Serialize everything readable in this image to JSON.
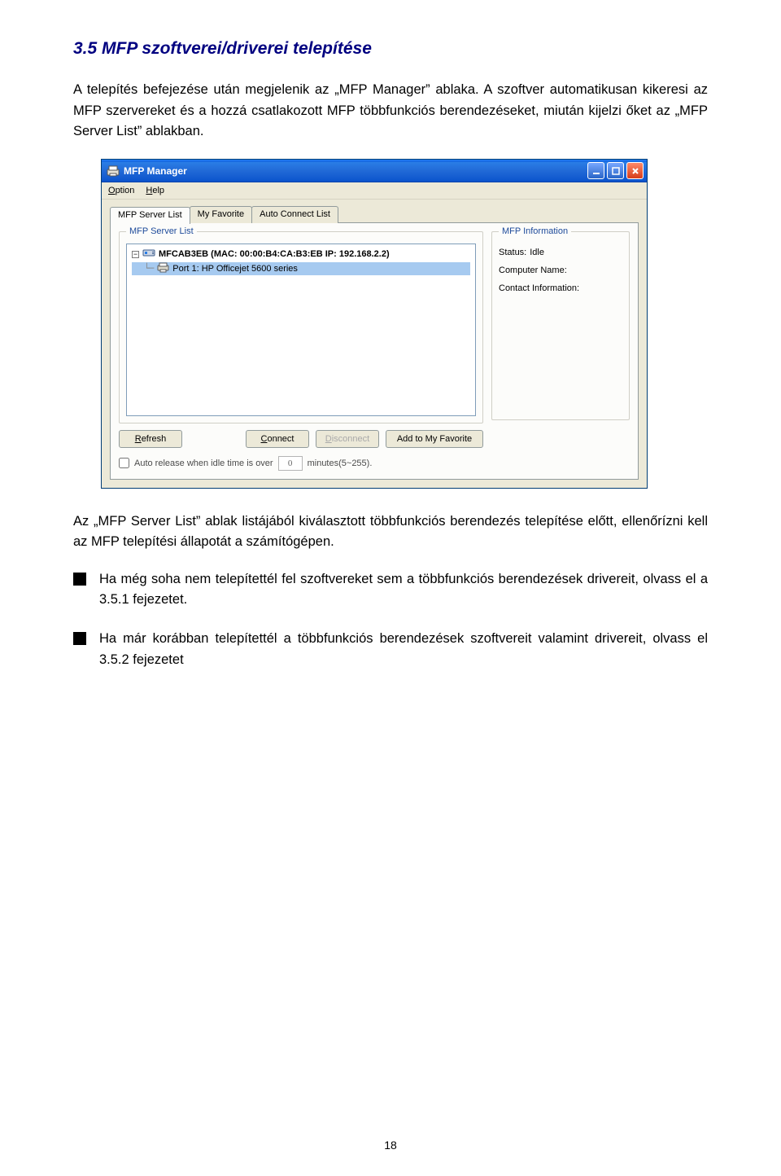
{
  "heading": "3.5 MFP szoftverei/driverei telepítése",
  "para1": "A telepítés befejezése után megjelenik az „MFP Manager” ablaka. A szoftver automatikusan kikeresi az MFP szervereket és a hozzá csatlakozott MFP többfunkciós berendezéseket, miután kijelzi őket az „MFP Server List” ablakban.",
  "para2": "Az „MFP Server List” ablak listájából kiválasztott többfunkciós berendezés telepítése előtt, ellenőrízni kell az MFP telepítési állapotát a számítógépen.",
  "bullets": [
    "Ha még soha nem telepítettél fel szoftvereket sem a többfunkciós berendezések drivereit, olvass el a 3.5.1 fejezetet.",
    "Ha már korábban telepítettél a többfunkciós berendezések szoftvereit valamint drivereit, olvass el 3.5.2 fejezetet"
  ],
  "pagenum": "18",
  "win": {
    "title": "MFP Manager",
    "menu": {
      "option": "Option",
      "help": "Help"
    },
    "tabs": {
      "list": "MFP Server List",
      "fav": "My Favorite",
      "auto": "Auto Connect List"
    },
    "groups": {
      "left": "MFP Server List",
      "right": "MFP Information"
    },
    "tree": {
      "server": "MFCAB3EB (MAC: 00:00:B4:CA:B3:EB   IP: 192.168.2.2)",
      "port": "Port 1: HP Officejet 5600 series"
    },
    "info": {
      "status_lbl": "Status:",
      "status_val": "Idle",
      "comp_lbl": "Computer Name:",
      "contact_lbl": "Contact Information:"
    },
    "buttons": {
      "refresh": "Refresh",
      "connect": "Connect",
      "disconnect": "Disconnect",
      "addfav": "Add to My Favorite"
    },
    "auto": {
      "label1": "Auto release when idle time is over",
      "value": "0",
      "label2": "minutes(5~255)."
    }
  }
}
